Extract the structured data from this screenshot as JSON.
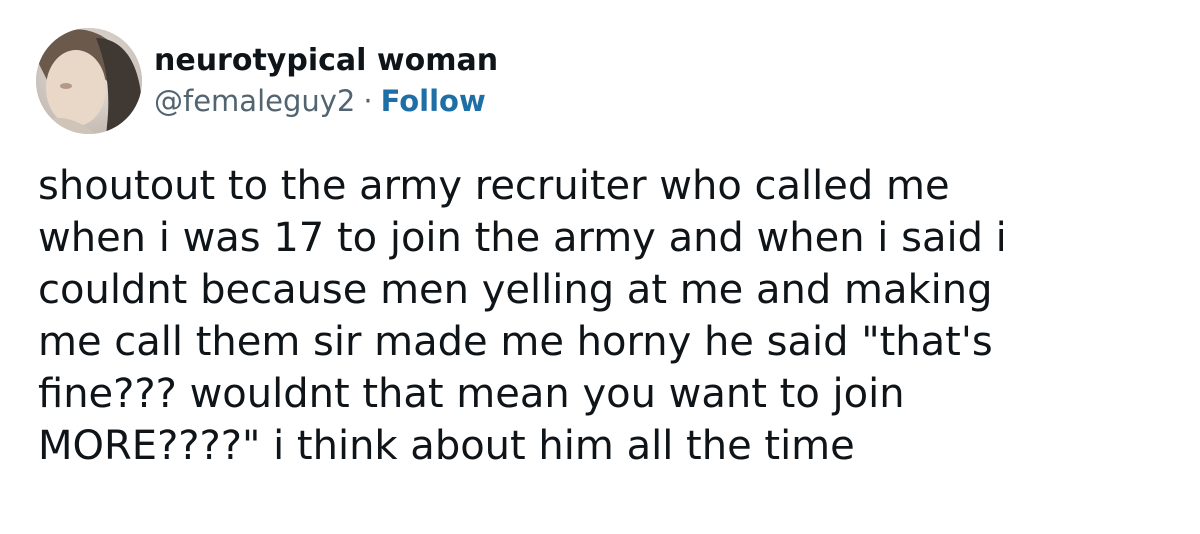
{
  "author": {
    "display_name": "neurotypical woman",
    "handle": "@femaleguy2",
    "separator": "·",
    "follow_label": "Follow",
    "avatar_icon": "profile-photo-icon"
  },
  "tweet": {
    "lines": [
      "shoutout to the army recruiter who called me",
      "when i was 17 to join the army and when i said i",
      "couldnt because men yelling at me and making",
      "me call them sir made me horny he said \"that's",
      "fine??? wouldnt that mean you want to join",
      "MORE????\" i think about him all the time"
    ]
  },
  "colors": {
    "text": "#0f1419",
    "secondary": "#536471",
    "link": "#1d6fa5",
    "background": "#ffffff"
  }
}
